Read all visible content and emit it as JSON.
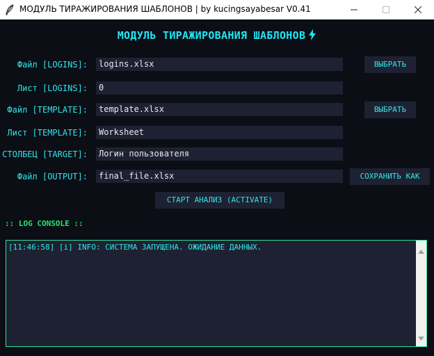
{
  "window": {
    "title": "МОДУЛЬ ТИРАЖИРОВАНИЯ ШАБЛОНОВ | by kucingsayabesar V0.41"
  },
  "header": {
    "title": "МОДУЛЬ ТИРАЖИРОВАНИЯ ШАБЛОНОВ",
    "icon": "lightning-icon"
  },
  "form": {
    "logins_file": {
      "label": "Файл [LOGINS]:",
      "value": "logins.xlsx"
    },
    "logins_sheet": {
      "label": "Лист [LOGINS]:",
      "value": "0"
    },
    "template_file": {
      "label": "Файл [TEMPLATE]:",
      "value": "template.xlsx"
    },
    "template_sheet": {
      "label": "Лист [TEMPLATE]:",
      "value": "Worksheet"
    },
    "target_column": {
      "label": "СТОЛБЕЦ [TARGET]:",
      "value": "Логин пользователя"
    },
    "output_file": {
      "label": "Файл [OUTPUT]:",
      "value": "final_file.xlsx"
    }
  },
  "buttons": {
    "select_logins": "ВЫБРАТЬ",
    "select_template": "ВЫБРАТЬ",
    "save_as": "СОХРАНИТЬ КАК",
    "start": "СТАРТ АНАЛИЗ (ACTIVATE)"
  },
  "log": {
    "title": ":: LOG CONSOLE ::",
    "lines": [
      "[11:46:58] [i] INFO: СИСТЕМА ЗАПУЩЕНА. ОЖИДАНИЕ ДАННЫХ."
    ]
  },
  "colors": {
    "accent_cyan": "#1fe6f2",
    "log_green": "#25e46a",
    "background": "#0c0e16",
    "field_bg": "#1e2131"
  }
}
